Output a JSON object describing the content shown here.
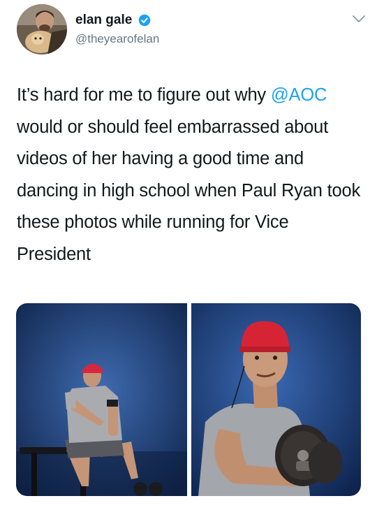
{
  "author": {
    "display_name": "elan gale",
    "handle": "@theyearofelan",
    "verified": true
  },
  "tweet": {
    "text_before": "It’s hard for me to figure out why ",
    "mention": "@AOC",
    "text_after": " would or should feel embarrassed about videos of her having a good time and dancing in high school when Paul Ryan took these photos while running for Vice President"
  },
  "colors": {
    "link": "#1da1f2",
    "verified_badge": "#1da1f2",
    "secondary_text": "#657786"
  },
  "icons": {
    "more": "chevron-down-icon",
    "verified": "verified-badge-icon"
  }
}
